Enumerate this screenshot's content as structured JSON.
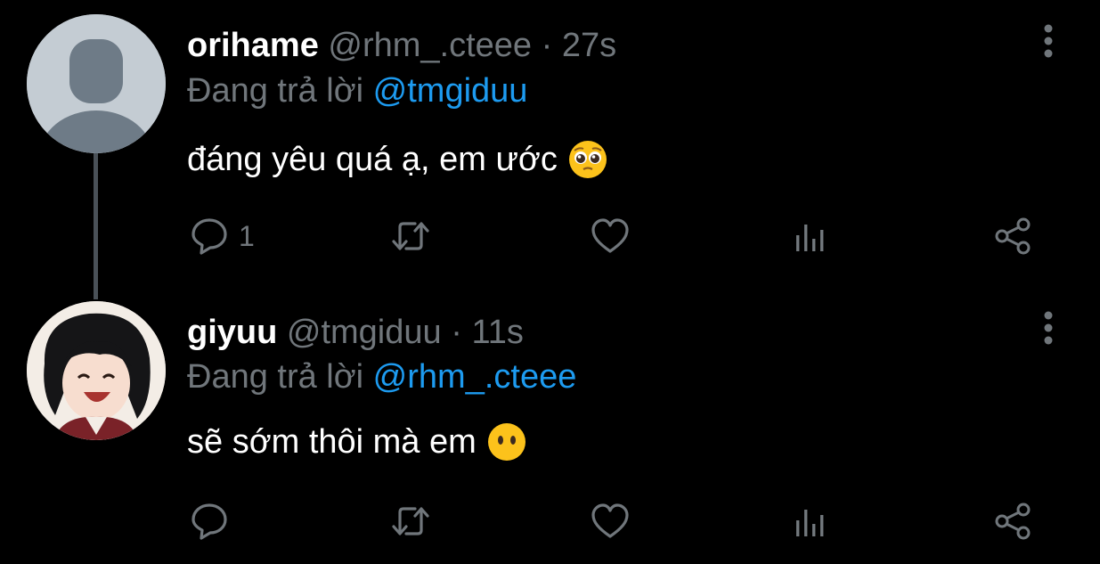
{
  "tweets": [
    {
      "name": "orihame",
      "handle": "@rhm_.cteee",
      "separator": "·",
      "time": "27s",
      "reply_prefix": "Đang trả lời",
      "reply_to": "@tmgiduu",
      "text": "đáng yêu quá ạ, em ước",
      "emoji": "pleading-face",
      "reply_count": "1",
      "avatar": "default-profile-avatar"
    },
    {
      "name": "giyuu",
      "handle": "@tmgiduu",
      "separator": "·",
      "time": "11s",
      "reply_prefix": "Đang trả lời",
      "reply_to": "@rhm_.cteee",
      "text": "sẽ sớm thôi mà em",
      "emoji": "face-without-mouth",
      "reply_count": "",
      "avatar": "anime-character-avatar"
    }
  ],
  "icons": [
    "reply-icon",
    "retweet-icon",
    "like-icon",
    "views-icon",
    "share-icon",
    "more-options-icon"
  ],
  "colors": {
    "background": "#000000",
    "text": "#ffffff",
    "secondary": "#70767b",
    "accent": "#1d9bf0",
    "thread_line": "#4a5158"
  }
}
